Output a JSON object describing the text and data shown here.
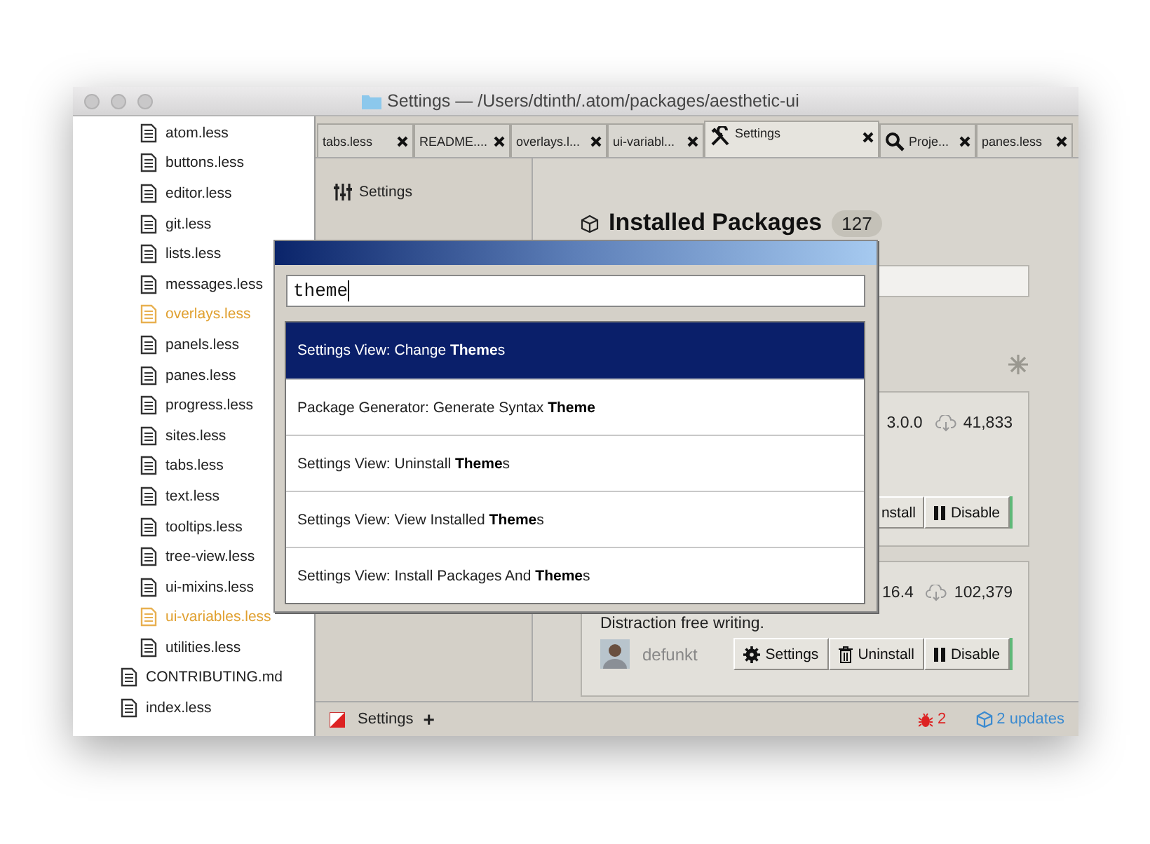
{
  "window": {
    "title": "Settings — /Users/dtinth/.atom/packages/aesthetic-ui"
  },
  "tree": {
    "items": [
      {
        "children": [
          {
            "name": "atom.less",
            "modified": false
          },
          {
            "name": "buttons.less",
            "modified": false
          },
          {
            "name": "editor.less",
            "modified": false
          },
          {
            "name": "git.less",
            "modified": false
          },
          {
            "name": "lists.less",
            "modified": false
          },
          {
            "name": "messages.less",
            "modified": false
          },
          {
            "name": "overlays.less",
            "modified": true
          },
          {
            "name": "panels.less",
            "modified": false
          },
          {
            "name": "panes.less",
            "modified": false
          },
          {
            "name": "progress.less",
            "modified": false
          },
          {
            "name": "sites.less",
            "modified": false
          },
          {
            "name": "tabs.less",
            "modified": false
          },
          {
            "name": "text.less",
            "modified": false
          },
          {
            "name": "tooltips.less",
            "modified": false
          },
          {
            "name": "tree-view.less",
            "modified": false
          },
          {
            "name": "ui-mixins.less",
            "modified": false
          },
          {
            "name": "ui-variables.less",
            "modified": true
          },
          {
            "name": "utilities.less",
            "modified": false
          }
        ]
      },
      {
        "name": "CONTRIBUTING.md",
        "modified": false
      },
      {
        "name": "index.less",
        "modified": false
      }
    ]
  },
  "tabs": [
    {
      "label": "tabs.less",
      "kind": "file",
      "selected": false
    },
    {
      "label": "README....",
      "kind": "file",
      "selected": false
    },
    {
      "label": "overlays.l...",
      "kind": "file",
      "selected": false
    },
    {
      "label": "ui-variabl...",
      "kind": "file",
      "selected": false
    },
    {
      "label": "Settings",
      "kind": "settings",
      "selected": true
    },
    {
      "label": "Proje...",
      "kind": "search",
      "selected": false
    },
    {
      "label": "panes.less",
      "kind": "file",
      "selected": false
    }
  ],
  "settings_nav": {
    "items": [
      {
        "label": "Settings"
      }
    ]
  },
  "content": {
    "heading": "Installed Packages",
    "count": "127"
  },
  "packages": [
    {
      "version": "3.0.0",
      "downloads": "41,833",
      "buttons": [
        {
          "kind": "uninstall",
          "label": "nstall"
        },
        {
          "kind": "disable",
          "label": "Disable"
        }
      ]
    },
    {
      "version": "16.4",
      "downloads": "102,379",
      "description": "Distraction free writing.",
      "author": "defunkt",
      "buttons": [
        {
          "kind": "settings",
          "label": "Settings"
        },
        {
          "kind": "uninstall",
          "label": "Uninstall"
        },
        {
          "kind": "disable",
          "label": "Disable"
        }
      ]
    }
  ],
  "status_bar": {
    "label": "Settings",
    "add": "+",
    "issues": "2",
    "updates": "2 updates"
  },
  "palette": {
    "query": "theme",
    "items": [
      {
        "text": "Settings View: Change **Theme**s",
        "selected": true
      },
      {
        "text": "Package Generator: Generate Syntax **Theme**",
        "selected": false
      },
      {
        "text": "Settings View: Uninstall **Theme**s",
        "selected": false
      },
      {
        "text": "Settings View: View Installed **Theme**s",
        "selected": false
      },
      {
        "text": "Settings View: Install Packages And **Theme**s",
        "selected": false
      }
    ]
  }
}
